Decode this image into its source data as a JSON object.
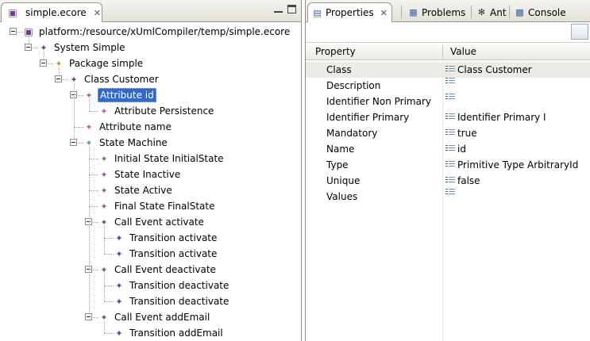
{
  "editor": {
    "tab_label": "simple.ecore",
    "tree": [
      {
        "label": "platform:/resource/xUmlCompiler/temp/simple.ecore",
        "icon": "resource-icon",
        "level": 0,
        "toggle": true
      },
      {
        "label": "System Simple",
        "icon": "system-icon",
        "level": 1,
        "toggle": true
      },
      {
        "label": "Package simple",
        "icon": "package-icon",
        "level": 2,
        "toggle": true
      },
      {
        "label": "Class Customer",
        "icon": "class-icon",
        "level": 3,
        "toggle": true
      },
      {
        "label": "Attribute id",
        "icon": "attribute-icon",
        "level": 4,
        "toggle": true,
        "selected": true
      },
      {
        "label": "Attribute Persistence",
        "icon": "attribute-icon",
        "level": 5,
        "toggle": false
      },
      {
        "label": "Attribute name",
        "icon": "attribute-icon",
        "level": 4,
        "toggle": false
      },
      {
        "label": "State Machine",
        "icon": "state-machine-icon",
        "level": 4,
        "toggle": true
      },
      {
        "label": "Initial State InitialState",
        "icon": "state-icon",
        "level": 5,
        "toggle": false
      },
      {
        "label": "State Inactive",
        "icon": "state-icon",
        "level": 5,
        "toggle": false
      },
      {
        "label": "State Active",
        "icon": "state-icon",
        "level": 5,
        "toggle": false
      },
      {
        "label": "Final State FinalState",
        "icon": "state-icon",
        "level": 5,
        "toggle": false
      },
      {
        "label": "Call Event activate",
        "icon": "event-icon",
        "level": 5,
        "toggle": true
      },
      {
        "label": "Transition activate",
        "icon": "transition-icon",
        "level": 6,
        "toggle": false
      },
      {
        "label": "Transition activate",
        "icon": "transition-icon",
        "level": 6,
        "toggle": false
      },
      {
        "label": "Call Event deactivate",
        "icon": "event-icon",
        "level": 5,
        "toggle": true
      },
      {
        "label": "Transition deactivate",
        "icon": "transition-icon",
        "level": 6,
        "toggle": false
      },
      {
        "label": "Transition deactivate",
        "icon": "transition-icon",
        "level": 6,
        "toggle": false
      },
      {
        "label": "Call Event addEmail",
        "icon": "event-icon",
        "level": 5,
        "toggle": true
      },
      {
        "label": "Transition addEmail",
        "icon": "transition-icon",
        "level": 6,
        "toggle": false
      }
    ]
  },
  "views": {
    "tabs": [
      {
        "label": "Properties",
        "icon": "properties-icon",
        "active": true,
        "closable": true
      },
      {
        "label": "Problems",
        "icon": "problems-icon",
        "active": false
      },
      {
        "label": "Ant",
        "icon": "ant-icon",
        "active": false
      },
      {
        "label": "Console",
        "icon": "console-icon",
        "active": false
      }
    ]
  },
  "properties": {
    "header": {
      "property": "Property",
      "value": "Value"
    },
    "rows": [
      {
        "name": "Class",
        "value": "Class Customer",
        "selected": true
      },
      {
        "name": "Description",
        "value": ""
      },
      {
        "name": "Identifier Non Primary",
        "value": ""
      },
      {
        "name": "Identifier Primary",
        "value": "Identifier Primary I"
      },
      {
        "name": "Mandatory",
        "value": "true"
      },
      {
        "name": "Name",
        "value": "id"
      },
      {
        "name": "Type",
        "value": "Primitive Type ArbitraryId"
      },
      {
        "name": "Unique",
        "value": "false"
      },
      {
        "name": "Values",
        "value": ""
      }
    ]
  }
}
